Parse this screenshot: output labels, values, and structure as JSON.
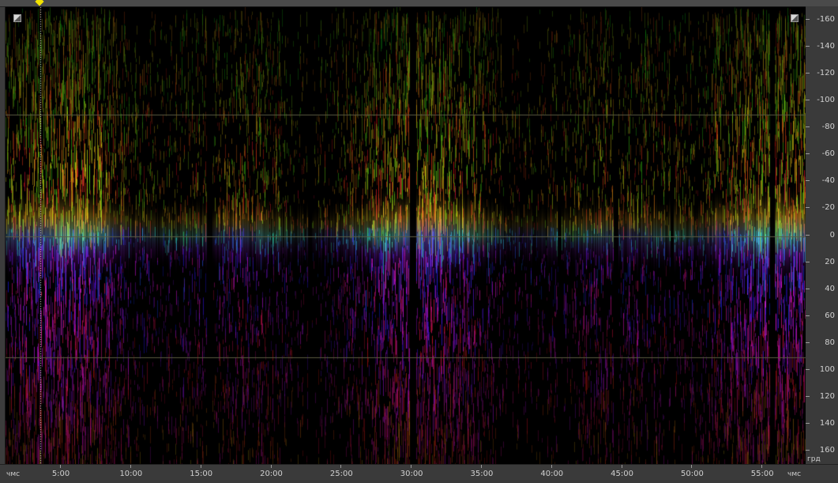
{
  "y_axis": {
    "unit": "грд",
    "labels": [
      "-160",
      "-140",
      "-120",
      "-100",
      "-80",
      "-60",
      "-40",
      "-20",
      "0",
      "20",
      "40",
      "60",
      "80",
      "100",
      "120",
      "140",
      "160"
    ],
    "values": [
      -160,
      -140,
      -120,
      -100,
      -80,
      -60,
      -40,
      -20,
      0,
      20,
      40,
      60,
      80,
      100,
      120,
      140,
      160
    ],
    "range": [
      -170,
      170
    ],
    "gridlines": [
      -90,
      0,
      90
    ]
  },
  "x_axis": {
    "unit_left": "чмс",
    "unit_right": "чмс",
    "labels": [
      "5:00",
      "10:00",
      "15:00",
      "20:00",
      "25:00",
      "30:00",
      "35:00",
      "40:00",
      "45:00",
      "50:00",
      "55:00"
    ],
    "values_seconds": [
      300,
      600,
      900,
      1200,
      1500,
      1800,
      2100,
      2400,
      2700,
      3000,
      3300
    ],
    "range_seconds": [
      60,
      3485
    ]
  },
  "playhead": {
    "time_seconds": 210,
    "color": "#f2e200"
  },
  "colors": {
    "background": "#000000",
    "gridline": "#5a5a40",
    "panel": "#3a3a3a",
    "axis_text": "#d0d0d0"
  },
  "icons": {
    "corner_left": "zoom-corner-icon",
    "corner_right": "zoom-corner-icon"
  }
}
